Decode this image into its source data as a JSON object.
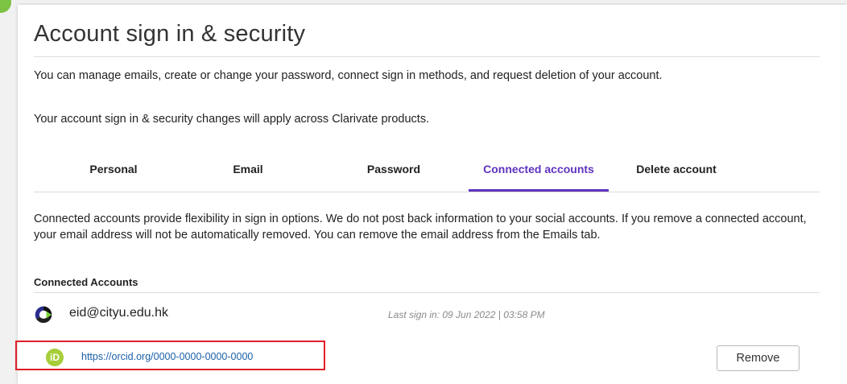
{
  "header": {
    "title": "Account sign in & security"
  },
  "intro": {
    "line1": "You can manage emails, create or change your password, connect sign in methods, and request deletion of your account.",
    "line2": "Your account sign in & security changes will apply across Clarivate products."
  },
  "tabs": [
    {
      "label": "Personal",
      "active": false
    },
    {
      "label": "Email",
      "active": false
    },
    {
      "label": "Password",
      "active": false
    },
    {
      "label": "Connected accounts",
      "active": true
    },
    {
      "label": "Delete account",
      "active": false
    }
  ],
  "connected": {
    "description": "Connected accounts provide flexibility in sign in options. We do not post back information to your social accounts. If you remove a connected account, your email address will not be automatically removed. You can remove the email address from the Emails tab.",
    "section_label": "Connected Accounts",
    "accounts": [
      {
        "icon": "clarivate-logo-icon",
        "identifier": "eid@cityu.edu.hk",
        "last_signin": "Last sign in: 09 Jun 2022 | 03:58 PM"
      },
      {
        "icon": "orcid-icon",
        "icon_text": "iD",
        "identifier": "https://orcid.org/0000-0000-0000-0000",
        "action_label": "Remove"
      }
    ]
  },
  "colors": {
    "accent": "#5e33bf",
    "link": "#1a5fa8",
    "highlight_border": "#e01e2a",
    "orcid_green": "#a6ce39"
  }
}
